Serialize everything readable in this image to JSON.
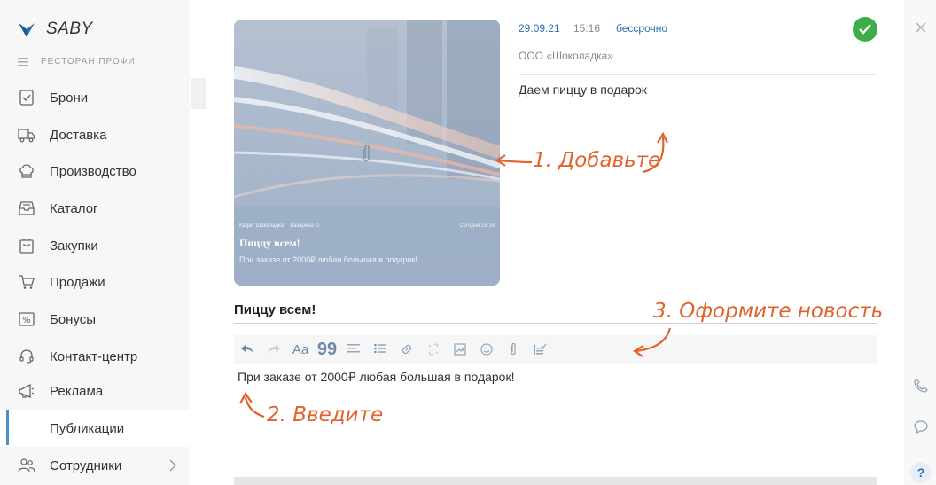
{
  "app": {
    "logo_text": "SABY",
    "org_name": "РЕСТОРАН ПРОФИ"
  },
  "sidebar": {
    "items": [
      {
        "label": "Брони",
        "icon": "calendar-check-icon"
      },
      {
        "label": "Доставка",
        "icon": "delivery-truck-icon"
      },
      {
        "label": "Производство",
        "icon": "chef-hat-icon"
      },
      {
        "label": "Каталог",
        "icon": "catalog-tray-icon"
      },
      {
        "label": "Закупки",
        "icon": "purchase-bag-icon"
      },
      {
        "label": "Продажи",
        "icon": "cart-icon"
      },
      {
        "label": "Бонусы",
        "icon": "percent-icon"
      },
      {
        "label": "Контакт-центр",
        "icon": "headset-icon"
      },
      {
        "label": "Реклама",
        "icon": "megaphone-icon"
      },
      {
        "label": "Публикации",
        "icon": ""
      },
      {
        "label": "Сотрудники",
        "icon": "people-icon"
      }
    ]
  },
  "card": {
    "footer_left": "Кафе \"Шоколадка\"   Лазарева О.",
    "footer_right": "Сегодня 15:18",
    "title": "Пиццу всем!",
    "subtitle": "При заказе от 2000₽ любая большая в подарок!"
  },
  "meta": {
    "date": "29.09.21",
    "time": "15:16",
    "term": "бессрочно",
    "org": "ООО «Шоколадка»",
    "description": "Даем пиццу в подарок"
  },
  "editor": {
    "title": "Пиццу всем!",
    "body": "При заказе от 2000₽ любая большая в подарок!"
  },
  "annotations": {
    "add": "1. Добавьте",
    "enter": "2. Введите",
    "format": "3. Оформите новость"
  },
  "colors": {
    "accent": "#2a6fb0",
    "annotation": "#e2622b",
    "success": "#3fac4a"
  }
}
